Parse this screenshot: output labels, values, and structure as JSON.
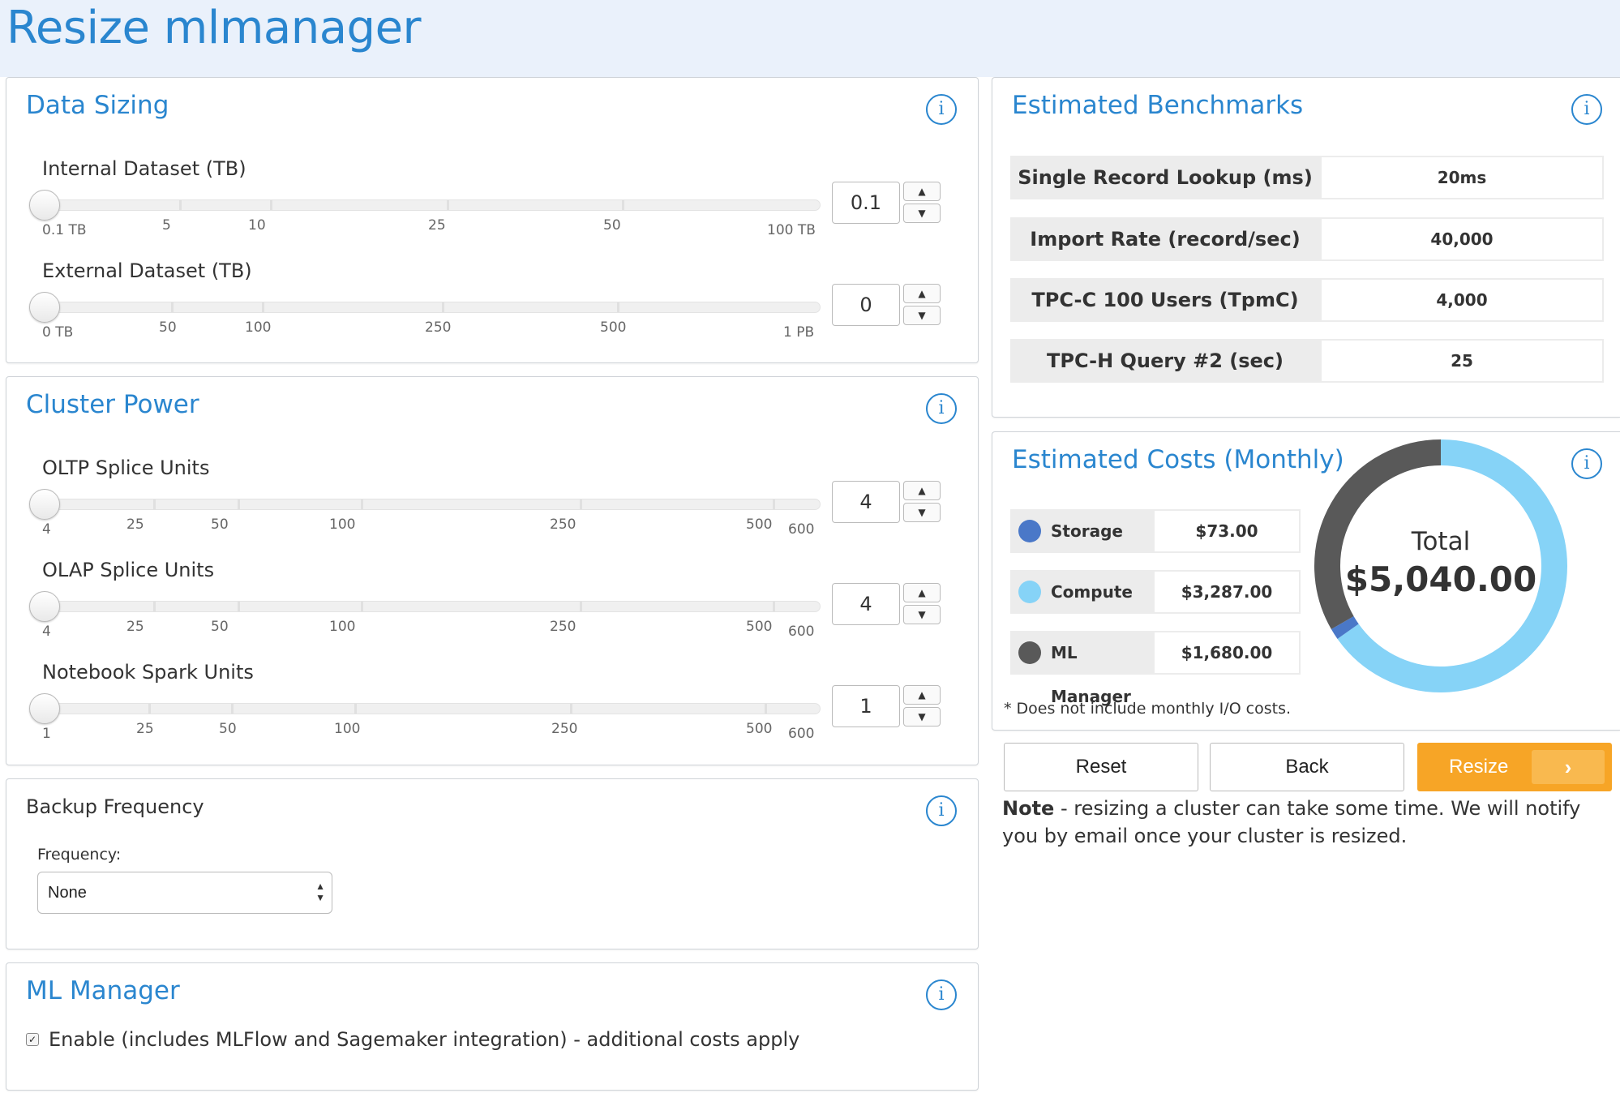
{
  "page": {
    "title": "Resize mlmanager"
  },
  "data_sizing": {
    "title": "Data Sizing",
    "sliders": [
      {
        "label": "Internal Dataset (TB)",
        "value": "0.1",
        "ticks": [
          "0.1 TB",
          "5",
          "10",
          "25",
          "50",
          "100 TB"
        ]
      },
      {
        "label": "External Dataset (TB)",
        "value": "0",
        "ticks": [
          "0 TB",
          "50",
          "100",
          "250",
          "500",
          "1 PB"
        ]
      }
    ]
  },
  "cluster_power": {
    "title": "Cluster Power",
    "sliders": [
      {
        "label": "OLTP Splice Units",
        "value": "4",
        "ticks": [
          "4",
          "25",
          "50",
          "100",
          "250",
          "500",
          "600"
        ]
      },
      {
        "label": "OLAP Splice Units",
        "value": "4",
        "ticks": [
          "4",
          "25",
          "50",
          "100",
          "250",
          "500",
          "600"
        ]
      },
      {
        "label": "Notebook Spark Units",
        "value": "1",
        "ticks": [
          "1",
          "25",
          "50",
          "100",
          "250",
          "500",
          "600"
        ]
      }
    ]
  },
  "backup": {
    "title": "Backup Frequency",
    "frequency_label": "Frequency:",
    "frequency_value": "None"
  },
  "ml_manager": {
    "title": "ML Manager",
    "enable_label": "Enable (includes MLFlow and Sagemaker integration) - additional costs apply",
    "enabled": true
  },
  "benchmarks": {
    "title": "Estimated Benchmarks",
    "rows": [
      {
        "label": "Single Record Lookup (ms)",
        "value": "20ms"
      },
      {
        "label": "Import Rate (record/sec)",
        "value": "40,000"
      },
      {
        "label": "TPC-C 100 Users (TpmC)",
        "value": "4,000"
      },
      {
        "label": "TPC-H Query #2 (sec)",
        "value": "25"
      }
    ]
  },
  "costs": {
    "title": "Estimated Costs (Monthly)",
    "rows": [
      {
        "label": "Storage",
        "value": "$73.00",
        "color": "#4a78c8",
        "amount": 73
      },
      {
        "label": "Compute",
        "value": "$3,287.00",
        "color": "#86d3f7",
        "amount": 3287
      },
      {
        "label": "ML Manager",
        "value": "$1,680.00",
        "color": "#595959",
        "amount": 1680
      }
    ],
    "total_label": "Total",
    "total_value": "$5,040.00",
    "footnote": "* Does not include monthly I/O costs."
  },
  "actions": {
    "reset": "Reset",
    "back": "Back",
    "resize": "Resize",
    "note_bold": "Note",
    "note_text": " - resizing a cluster can take some time. We will notify you by email once your cluster is resized."
  },
  "colors": {
    "accent": "#2a86cf",
    "primary_button": "#f7a526"
  }
}
